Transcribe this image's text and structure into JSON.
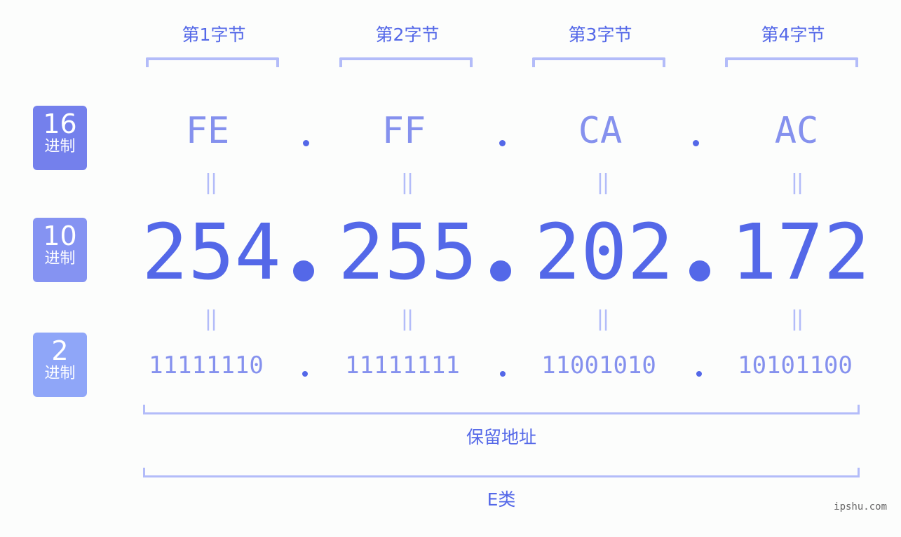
{
  "bytes": [
    {
      "label": "第1字节",
      "hex": "FE",
      "dec": "254",
      "bin": "11111110"
    },
    {
      "label": "第2字节",
      "hex": "FF",
      "dec": "255",
      "bin": "11111111"
    },
    {
      "label": "第3字节",
      "hex": "CA",
      "dec": "202",
      "bin": "11001010"
    },
    {
      "label": "第4字节",
      "hex": "AC",
      "dec": "172",
      "bin": "10101100"
    }
  ],
  "badges": [
    {
      "num": "16",
      "unit": "进制",
      "color": "#7480ec"
    },
    {
      "num": "10",
      "unit": "进制",
      "color": "#8593f2"
    },
    {
      "num": "2",
      "unit": "进制",
      "color": "#8fa6f8"
    }
  ],
  "equals_sign": "||",
  "address_type": "保留地址",
  "address_class": "E类",
  "watermark": "ipshu.com"
}
